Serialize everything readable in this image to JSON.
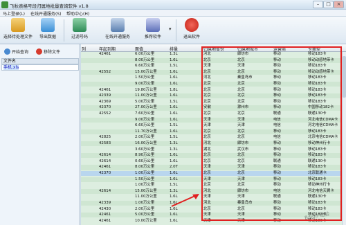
{
  "window": {
    "title": "飞秋表格号段归属地批量查询软件 v1.8",
    "controls": [
      "–",
      "□",
      "×"
    ]
  },
  "menu": [
    "马上登录(L)",
    "在线开通服务(S)",
    "帮助中心(H)"
  ],
  "toolbar": [
    {
      "label": "选择待处理文件",
      "icon": "folder-open-icon",
      "color": "#e6b23c"
    },
    {
      "label": "导出数据",
      "icon": "export-icon",
      "color": "#3b8fd6"
    },
    {
      "label": "过滤号码",
      "icon": "excel-filter-icon",
      "color": "#2e8b57"
    },
    {
      "label": "在线开通服务",
      "icon": "cart-icon",
      "color": "#5a7fb0"
    },
    {
      "label": "推荐软件",
      "icon": "gift-icon",
      "color": "#5c6fb8"
    },
    {
      "label": "退出软件",
      "icon": "power-icon",
      "color": "#d9281c"
    }
  ],
  "left_pane": {
    "start_button": "开始查询",
    "remove_button": "移除文件",
    "file_header": "文件名",
    "file_name": "手机.xls"
  },
  "grid": {
    "columns": [
      "列",
      "年起到期",
      "面值",
      "排量",
      "归属地省份",
      "归属地城市",
      "运营商",
      "卡类型"
    ],
    "rows": [
      [
        "42461",
        "6.00万公里",
        "1.3L",
        "河北",
        "廊坊市",
        "移动",
        "移动183卡"
      ],
      [
        "",
        "8.00万公里",
        "1.6L",
        "北京",
        "北京",
        "移动",
        "移动动感地带卡"
      ],
      [
        "",
        "6.60万公里",
        "1.5L",
        "天津",
        "天津",
        "移动",
        "移动183卡"
      ],
      [
        "42552",
        "15.00万公里",
        "1.6L",
        "北京",
        "北京",
        "移动",
        "移动动感地带卡"
      ],
      [
        "",
        "1.50万公里",
        "1.6L",
        "河北",
        "秦皇岛市",
        "移动",
        "移动183卡"
      ],
      [
        "",
        "9.00万公里",
        "1.6L",
        "北京",
        "北京",
        "移动",
        "移动183卡"
      ],
      [
        "42461",
        "19.80万公里",
        "1.8L",
        "北京",
        "北京",
        "移动",
        "移动183卡"
      ],
      [
        "42339",
        "11.00万公里",
        "1.6L",
        "北京",
        "北京",
        "移动",
        "移动183卡"
      ],
      [
        "42369",
        "5.00万公里",
        "1.5L",
        "北京",
        "北京",
        "移动",
        "移动183卡"
      ],
      [
        "42370",
        "27.00万公里",
        "1.6L",
        "安徽",
        "滁州市",
        "移动",
        "中国移动182卡"
      ],
      [
        "42552",
        "7.60万公里",
        "1.6L",
        "北京",
        "北京",
        "联通",
        "联通130卡"
      ],
      [
        "",
        "9.00万公里",
        "1.6L",
        "天津",
        "天津",
        "电信",
        "河北电信CDMA卡"
      ],
      [
        "",
        "6.60万公里",
        "1.5L",
        "天津",
        "天津",
        "电信",
        "河北电信CDMA卡"
      ],
      [
        "",
        "11.70万公里",
        "1.6L",
        "北京",
        "北京",
        "移动",
        "移动183卡"
      ],
      [
        "42825",
        "2.00万公里",
        "1.5L",
        "北京",
        "北京",
        "电信",
        "北京电信CDMA卡"
      ],
      [
        "42583",
        "16.00万公里",
        "1.3L",
        "河北",
        "廊坊市",
        "移动",
        "移动神州行卡"
      ],
      [
        "",
        "3.60万公里",
        "1.3L",
        "湖北",
        "武汉市",
        "移动",
        "移动183卡"
      ],
      [
        "42614",
        "8.90万公里",
        "1.6L",
        "北京",
        "北京",
        "移动",
        "移动183卡"
      ],
      [
        "42614",
        "0.60万公里",
        "1.6L",
        "北京",
        "北京",
        "联通",
        "联通130卡"
      ],
      [
        "42461",
        "8.00万公里",
        "2.0T",
        "天津",
        "天津",
        "移动",
        "移动183卡"
      ],
      [
        "42370",
        "1.00万公里",
        "1.6L",
        "北京",
        "北京",
        "移动",
        "北京联通卡"
      ],
      [
        "",
        "1.50万公里",
        "1.6L",
        "天津",
        "天津",
        "移动",
        "移动183卡"
      ],
      [
        "",
        "1.00万公里",
        "1.5L",
        "北京",
        "北京",
        "移动",
        "移动神州行卡"
      ],
      [
        "42614",
        "15.00万公里",
        "1.3L",
        "河北",
        "廊坊市",
        "电信",
        "河北电信天翼卡"
      ],
      [
        "",
        "11.00万公里",
        "1.6L",
        "天津",
        "天津",
        "联通",
        "联通130卡"
      ],
      [
        "42339",
        "1.00万公里",
        "1.6L",
        "河北",
        "秦皇岛市",
        "移动",
        "移动183卡"
      ],
      [
        "42430",
        "2.00万公里",
        "1.6L",
        "北京",
        "北京",
        "移动",
        "移动183卡"
      ],
      [
        "42461",
        "5.00万公里",
        "1.6L",
        "天津",
        "天津",
        "移动",
        "移动183卡"
      ],
      [
        "42461",
        "10.00万公里",
        "1.6L",
        "天津",
        "天津",
        "移动",
        "移动183卡"
      ]
    ]
  },
  "watermark": "Baidu 经验"
}
